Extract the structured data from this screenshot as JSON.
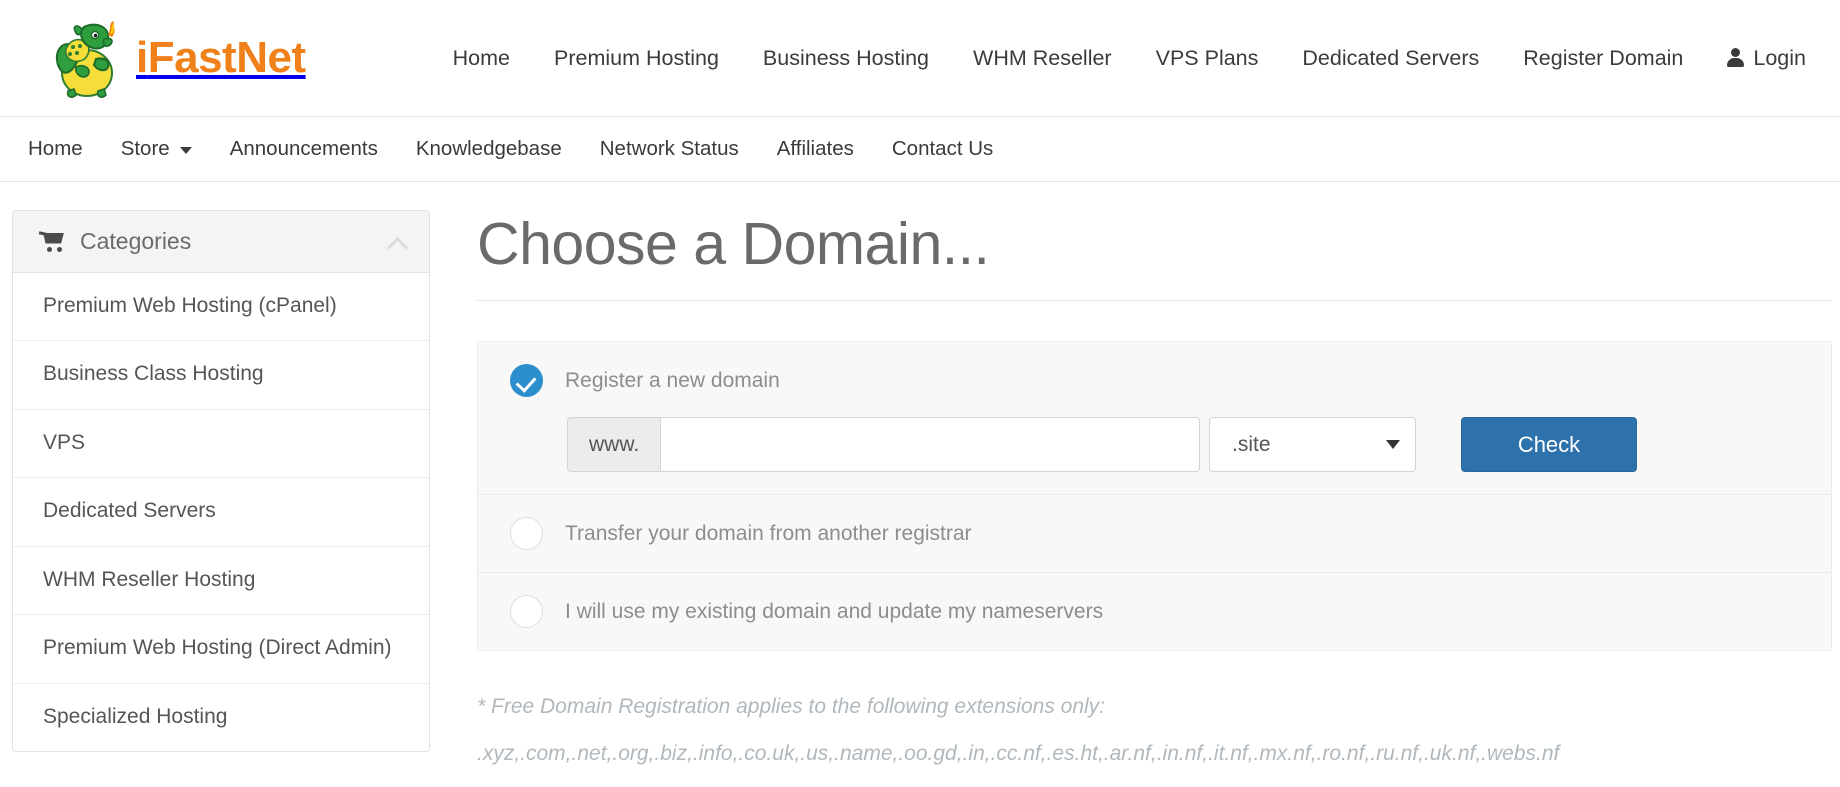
{
  "header": {
    "brand": {
      "prefix": "i",
      "rest": "FastNet",
      "logo_icon": "dragon-mascot-logo"
    },
    "nav": [
      {
        "label": "Home"
      },
      {
        "label": "Premium Hosting"
      },
      {
        "label": "Business Hosting"
      },
      {
        "label": "WHM Reseller"
      },
      {
        "label": "VPS Plans"
      },
      {
        "label": "Dedicated Servers"
      },
      {
        "label": "Register Domain"
      }
    ],
    "login": {
      "label": "Login",
      "icon": "user-icon"
    }
  },
  "subnav": [
    {
      "label": "Home",
      "caret": false
    },
    {
      "label": "Store",
      "caret": true
    },
    {
      "label": "Announcements",
      "caret": false
    },
    {
      "label": "Knowledgebase",
      "caret": false
    },
    {
      "label": "Network Status",
      "caret": false
    },
    {
      "label": "Affiliates",
      "caret": false
    },
    {
      "label": "Contact Us",
      "caret": false
    }
  ],
  "sidebar": {
    "title": "Categories",
    "icon": "shopping-cart-icon",
    "collapse_icon": "chevron-up-icon",
    "items": [
      {
        "label": "Premium Web Hosting (cPanel)"
      },
      {
        "label": "Business Class Hosting"
      },
      {
        "label": "VPS"
      },
      {
        "label": "Dedicated Servers"
      },
      {
        "label": "WHM Reseller Hosting"
      },
      {
        "label": "Premium Web Hosting (Direct Admin)"
      },
      {
        "label": "Specialized Hosting"
      }
    ]
  },
  "main": {
    "title": "Choose a Domain...",
    "options": [
      {
        "label": "Register a new domain",
        "selected": true
      },
      {
        "label": "Transfer your domain from another registrar",
        "selected": false
      },
      {
        "label": "I will use my existing domain and update my nameservers",
        "selected": false
      }
    ],
    "domain_form": {
      "prefix": "www.",
      "value": "",
      "placeholder": "",
      "tld_selected": ".site",
      "tld_options": [
        ".site",
        ".xyz",
        ".com",
        ".net",
        ".org",
        ".biz",
        ".info",
        ".co.uk",
        ".us",
        ".name"
      ],
      "check_label": "Check"
    },
    "free_note": "* Free Domain Registration applies to the following extensions only:",
    "free_extensions": ".xyz,.com,.net,.org,.biz,.info,.co.uk,.us,.name,.oo.gd,.in,.cc.nf,.es.ht,.ar.nf,.in.nf,.it.nf,.mx.nf,.ro.nf,.ru.nf,.uk.nf,.webs.nf"
  },
  "colors": {
    "brand_orange": "#f08019",
    "accent_blue": "#2a8fcc",
    "button_blue": "#2d72ab",
    "text_gray": "#555555"
  }
}
